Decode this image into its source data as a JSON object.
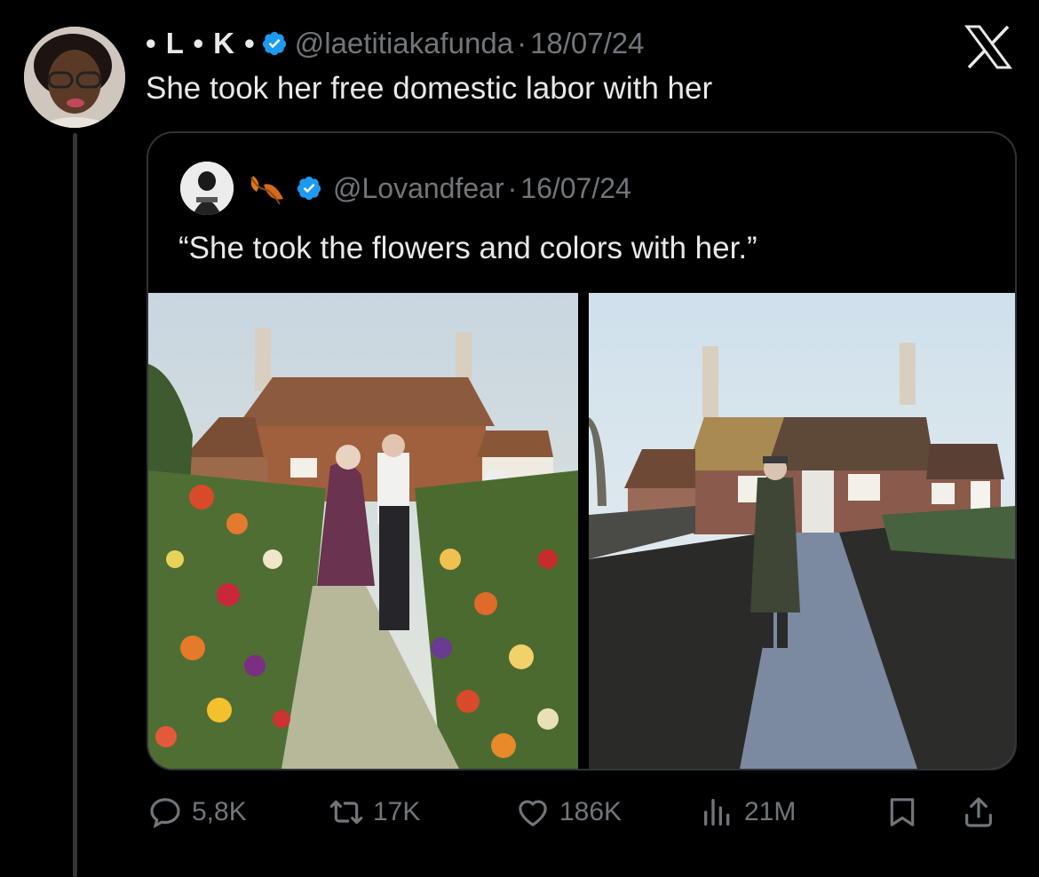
{
  "tweet": {
    "display_name": "• L • K •",
    "handle": "@laetitiakafunda",
    "separator": "·",
    "date": "18/07/24",
    "text": "She took her free domestic labor with her"
  },
  "quoted_tweet": {
    "handle": "@Lovandfear",
    "separator": "·",
    "date": "16/07/24",
    "text": "“She took the flowers and colors with her.”",
    "media": [
      "photo-couple-flower-garden",
      "photo-man-bare-garden"
    ]
  },
  "actions": {
    "replies": "5,8K",
    "reposts": "17K",
    "likes": "186K",
    "views": "21M"
  },
  "icons": {
    "verified": "verified-badge-icon",
    "logo": "x-logo-icon",
    "reply": "reply-icon",
    "repost": "repost-icon",
    "like": "heart-icon",
    "views": "views-icon",
    "bookmark": "bookmark-icon",
    "share": "share-icon"
  },
  "colors": {
    "background": "#000000",
    "text": "#e7e9ea",
    "muted": "#71767b",
    "verified": "#1d9bf0",
    "border": "#2f3336"
  }
}
